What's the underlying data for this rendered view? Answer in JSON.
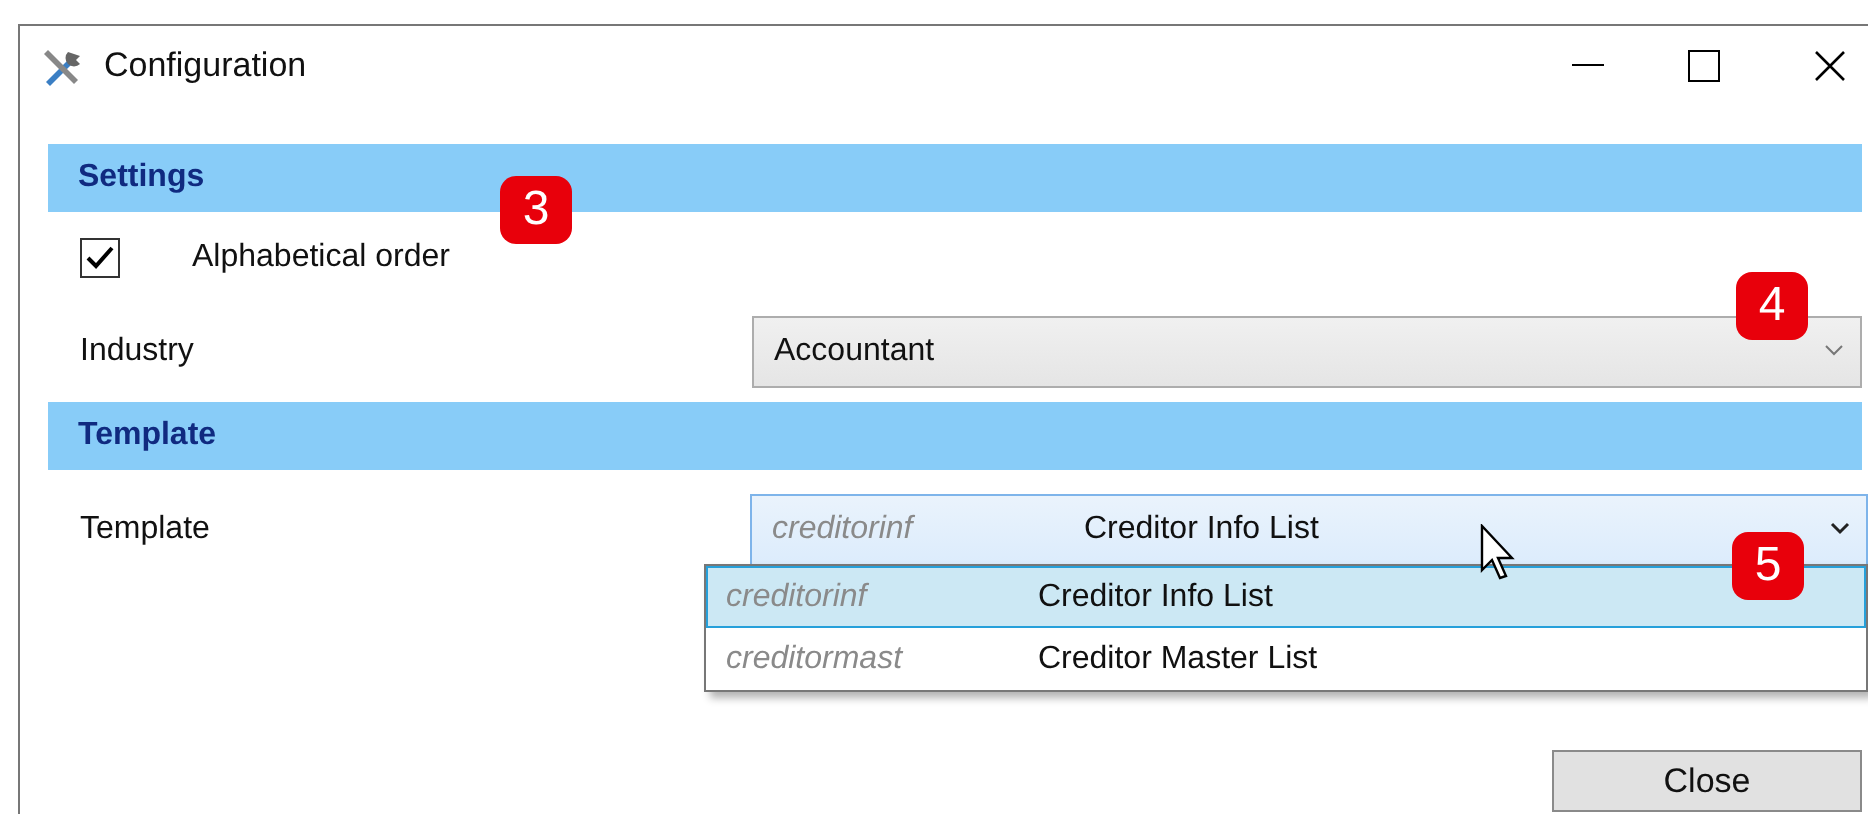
{
  "window": {
    "title": "Configuration"
  },
  "settings": {
    "header": "Settings",
    "alphabetical": {
      "label": "Alphabetical order",
      "checked": true
    },
    "industry": {
      "label": "Industry",
      "value": "Accountant"
    }
  },
  "template": {
    "header": "Template",
    "label": "Template",
    "value": {
      "code": "creditorinf",
      "name": "Creditor Info List"
    },
    "expanded": true,
    "options": [
      {
        "code": "creditorinf",
        "name": "Creditor Info List",
        "selected": true
      },
      {
        "code": "creditormast",
        "name": "Creditor Master List",
        "selected": false
      }
    ]
  },
  "callouts": [
    "3",
    "4",
    "5"
  ],
  "buttons": [
    "Close"
  ]
}
